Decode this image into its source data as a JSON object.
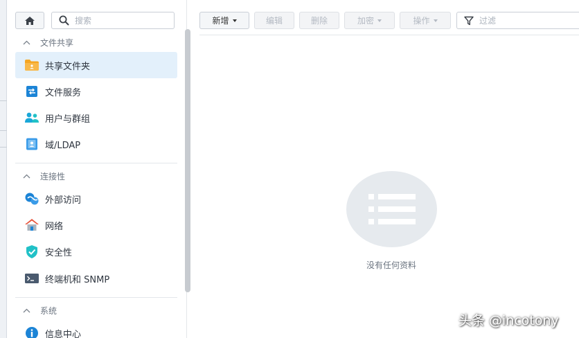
{
  "search": {
    "placeholder": "搜索"
  },
  "sidebar": {
    "sections": [
      {
        "title": "文件共享",
        "collapse_icon": "chevron-up-icon",
        "items": [
          {
            "label": "共享文件夹",
            "icon": "folder-icon",
            "active": true
          },
          {
            "label": "文件服务",
            "icon": "file-services-icon"
          },
          {
            "label": "用户与群组",
            "icon": "users-icon"
          },
          {
            "label": "域/LDAP",
            "icon": "domain-icon"
          }
        ]
      },
      {
        "title": "连接性",
        "collapse_icon": "chevron-up-icon",
        "items": [
          {
            "label": "外部访问",
            "icon": "external-access-icon"
          },
          {
            "label": "网络",
            "icon": "network-icon"
          },
          {
            "label": "安全性",
            "icon": "shield-icon"
          },
          {
            "label": "终端机和 SNMP",
            "icon": "terminal-icon"
          }
        ]
      },
      {
        "title": "系统",
        "collapse_icon": "chevron-up-icon",
        "items": [
          {
            "label": "信息中心",
            "icon": "info-icon"
          }
        ]
      }
    ]
  },
  "toolbar": {
    "buttons": [
      {
        "label": "新增",
        "has_dropdown": true,
        "enabled": true
      },
      {
        "label": "编辑",
        "has_dropdown": false,
        "enabled": false
      },
      {
        "label": "删除",
        "has_dropdown": false,
        "enabled": false
      },
      {
        "label": "加密",
        "has_dropdown": true,
        "enabled": false
      },
      {
        "label": "操作",
        "has_dropdown": true,
        "enabled": false
      }
    ],
    "filter": {
      "placeholder": "过滤"
    }
  },
  "main": {
    "empty_text": "没有任何资料"
  },
  "watermark": "头条 @incotony",
  "colors": {
    "accent": "#1c84d6",
    "active_bg": "#e3f0fb",
    "folder": "#f5a623",
    "users": "#1aa7d8",
    "shield": "#21c1c7",
    "network_roof": "#e8553d"
  }
}
